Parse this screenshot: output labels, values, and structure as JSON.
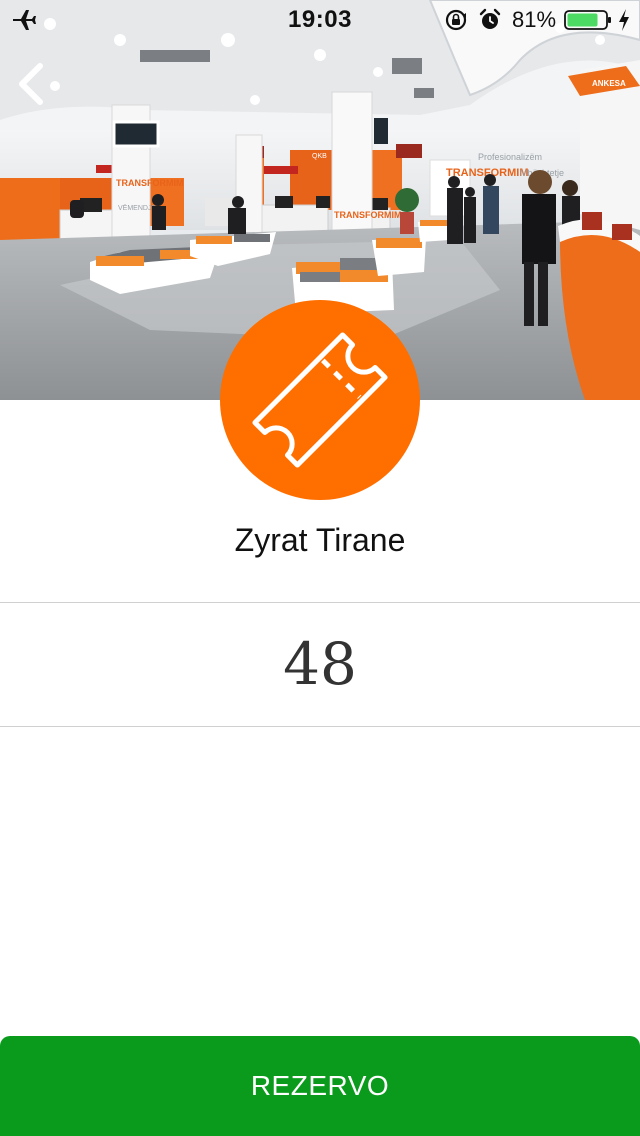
{
  "status_bar": {
    "time": "19:03",
    "battery_percent": "81%",
    "battery_level": 0.81,
    "battery_color": "#4cd964",
    "icons": [
      "airplane-icon",
      "orientation-lock-icon",
      "alarm-icon",
      "battery-icon",
      "charging-bolt-icon"
    ]
  },
  "header": {
    "back_icon": "chevron-left-icon"
  },
  "hero": {
    "signage": {
      "transformim": "TRANSFORMIM",
      "profesionalizem": "Profesionalizëm",
      "mbeshtetje": "Mbështetje",
      "vemendje": "VËMENDJE",
      "ankesa": "ANKESA",
      "qkb": "QKB"
    }
  },
  "badge": {
    "icon": "ticket-icon",
    "color": "#ff6f00"
  },
  "office": {
    "name": "Zyrat Tirane"
  },
  "queue": {
    "count": "48"
  },
  "actions": {
    "reserve_label": "REZERVO",
    "reserve_color": "#0a9b1d"
  }
}
